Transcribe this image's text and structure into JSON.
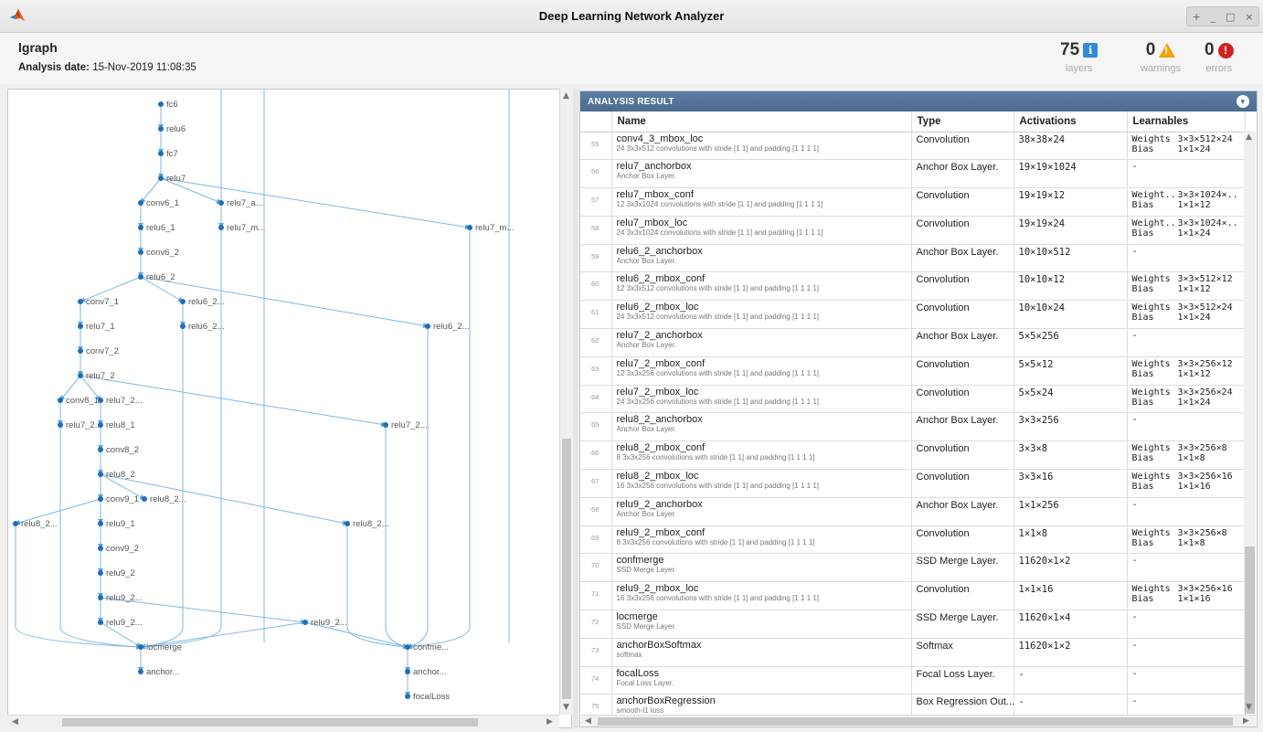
{
  "window": {
    "title": "Deep Learning Network Analyzer",
    "controls": [
      "+",
      "_",
      "□",
      "×"
    ]
  },
  "header": {
    "graph_name": "lgraph",
    "analysis_date_label": "Analysis date:",
    "analysis_date": "15-Nov-2019 11:08:35",
    "layers": {
      "count": "75",
      "label": "layers",
      "icon": "info-icon"
    },
    "warnings": {
      "count": "0",
      "label": "warnings",
      "icon": "warning-icon"
    },
    "errors": {
      "count": "0",
      "label": "errors",
      "icon": "error-icon"
    }
  },
  "graph": {
    "nodes": {
      "fc6": "fc6",
      "relu6": "relu6",
      "fc7": "fc7",
      "relu7": "relu7",
      "conv6_1": "conv6_1",
      "relu7_a": "relu7_a...",
      "relu6_1": "relu6_1",
      "relu7_m1": "relu7_m...",
      "relu7_m2": "relu7_m...",
      "conv6_2": "conv6_2",
      "relu6_2": "relu6_2",
      "conv7_1": "conv7_1",
      "relu6_2a": "relu6_2...",
      "relu7_1": "relu7_1",
      "relu6_2b": "relu6_2...",
      "relu6_2c": "relu6_2...",
      "conv7_2": "conv7_2",
      "relu7_2": "relu7_2",
      "conv8_1": "conv8_1",
      "relu7_2a": "relu7_2...",
      "relu7_2b": "relu7_2...",
      "relu8_1": "relu8_1",
      "relu7_2c": "relu7_2...",
      "conv8_2": "conv8_2",
      "relu8_2": "relu8_2",
      "conv9_1": "conv9_1",
      "relu8_2a": "relu8_2...",
      "relu8_2b": "relu8_2...",
      "relu9_1": "relu9_1",
      "relu8_2c": "relu8_2...",
      "conv9_2": "conv9_2",
      "relu9_2": "relu9_2",
      "relu9_2a": "relu9_2...",
      "relu9_2b": "relu9_2...",
      "relu9_2c": "relu9_2...",
      "locmerge": "locmerge",
      "confme": "confme...",
      "anchor": "anchor...",
      "anchor2": "anchor...",
      "focalLoss": "focalLoss"
    }
  },
  "result": {
    "title": "ANALYSIS RESULT",
    "columns": [
      "",
      "Name",
      "Type",
      "Activations",
      "Learnables"
    ],
    "rows": [
      {
        "idx": "55",
        "name": "conv4_3_mbox_loc",
        "desc": "24 3x3x512 convolutions with stride [1 1] and padding [1 1 1 1]",
        "type": "Convolution",
        "act": "38×38×24",
        "l1k": "Weights",
        "l1v": "3×3×512×24",
        "l2k": "Bias",
        "l2v": "1×1×24"
      },
      {
        "idx": "56",
        "name": "relu7_anchorbox",
        "desc": "Anchor Box Layer.",
        "type": "Anchor Box Layer.",
        "act": "19×19×1024",
        "l1k": "-",
        "l1v": "",
        "l2k": "",
        "l2v": ""
      },
      {
        "idx": "57",
        "name": "relu7_mbox_conf",
        "desc": "12 3x3x1024 convolutions with stride [1 1] and padding [1 1 1 1]",
        "type": "Convolution",
        "act": "19×19×12",
        "l1k": "Weight..",
        "l1v": "3×3×1024×..",
        "l2k": "Bias",
        "l2v": "1×1×12"
      },
      {
        "idx": "58",
        "name": "relu7_mbox_loc",
        "desc": "24 3x3x1024 convolutions with stride [1 1] and padding [1 1 1 1]",
        "type": "Convolution",
        "act": "19×19×24",
        "l1k": "Weight..",
        "l1v": "3×3×1024×..",
        "l2k": "Bias",
        "l2v": "1×1×24"
      },
      {
        "idx": "59",
        "name": "relu6_2_anchorbox",
        "desc": "Anchor Box Layer.",
        "type": "Anchor Box Layer.",
        "act": "10×10×512",
        "l1k": "-",
        "l1v": "",
        "l2k": "",
        "l2v": ""
      },
      {
        "idx": "60",
        "name": "relu6_2_mbox_conf",
        "desc": "12 3x3x512 convolutions with stride [1 1] and padding [1 1 1 1]",
        "type": "Convolution",
        "act": "10×10×12",
        "l1k": "Weights",
        "l1v": "3×3×512×12",
        "l2k": "Bias",
        "l2v": "1×1×12"
      },
      {
        "idx": "61",
        "name": "relu6_2_mbox_loc",
        "desc": "24 3x3x512 convolutions with stride [1 1] and padding [1 1 1 1]",
        "type": "Convolution",
        "act": "10×10×24",
        "l1k": "Weights",
        "l1v": "3×3×512×24",
        "l2k": "Bias",
        "l2v": "1×1×24"
      },
      {
        "idx": "62",
        "name": "relu7_2_anchorbox",
        "desc": "Anchor Box Layer.",
        "type": "Anchor Box Layer.",
        "act": "5×5×256",
        "l1k": "-",
        "l1v": "",
        "l2k": "",
        "l2v": ""
      },
      {
        "idx": "63",
        "name": "relu7_2_mbox_conf",
        "desc": "12 3x3x256 convolutions with stride [1 1] and padding [1 1 1 1]",
        "type": "Convolution",
        "act": "5×5×12",
        "l1k": "Weights",
        "l1v": "3×3×256×12",
        "l2k": "Bias",
        "l2v": "1×1×12"
      },
      {
        "idx": "64",
        "name": "relu7_2_mbox_loc",
        "desc": "24 3x3x256 convolutions with stride [1 1] and padding [1 1 1 1]",
        "type": "Convolution",
        "act": "5×5×24",
        "l1k": "Weights",
        "l1v": "3×3×256×24",
        "l2k": "Bias",
        "l2v": "1×1×24"
      },
      {
        "idx": "65",
        "name": "relu8_2_anchorbox",
        "desc": "Anchor Box Layer.",
        "type": "Anchor Box Layer.",
        "act": "3×3×256",
        "l1k": "-",
        "l1v": "",
        "l2k": "",
        "l2v": ""
      },
      {
        "idx": "66",
        "name": "relu8_2_mbox_conf",
        "desc": "8 3x3x256 convolutions with stride [1 1] and padding [1 1 1 1]",
        "type": "Convolution",
        "act": "3×3×8",
        "l1k": "Weights",
        "l1v": "3×3×256×8",
        "l2k": "Bias",
        "l2v": "1×1×8"
      },
      {
        "idx": "67",
        "name": "relu8_2_mbox_loc",
        "desc": "16 3x3x256 convolutions with stride [1 1] and padding [1 1 1 1]",
        "type": "Convolution",
        "act": "3×3×16",
        "l1k": "Weights",
        "l1v": "3×3×256×16",
        "l2k": "Bias",
        "l2v": "1×1×16"
      },
      {
        "idx": "68",
        "name": "relu9_2_anchorbox",
        "desc": "Anchor Box Layer.",
        "type": "Anchor Box Layer.",
        "act": "1×1×256",
        "l1k": "-",
        "l1v": "",
        "l2k": "",
        "l2v": ""
      },
      {
        "idx": "69",
        "name": "relu9_2_mbox_conf",
        "desc": "8 3x3x256 convolutions with stride [1 1] and padding [1 1 1 1]",
        "type": "Convolution",
        "act": "1×1×8",
        "l1k": "Weights",
        "l1v": "3×3×256×8",
        "l2k": "Bias",
        "l2v": "1×1×8"
      },
      {
        "idx": "70",
        "name": "confmerge",
        "desc": "SSD Merge Layer.",
        "type": "SSD Merge Layer.",
        "act": "11620×1×2",
        "l1k": "-",
        "l1v": "",
        "l2k": "",
        "l2v": ""
      },
      {
        "idx": "71",
        "name": "relu9_2_mbox_loc",
        "desc": "16 3x3x256 convolutions with stride [1 1] and padding [1 1 1 1]",
        "type": "Convolution",
        "act": "1×1×16",
        "l1k": "Weights",
        "l1v": "3×3×256×16",
        "l2k": "Bias",
        "l2v": "1×1×16"
      },
      {
        "idx": "72",
        "name": "locmerge",
        "desc": "SSD Merge Layer.",
        "type": "SSD Merge Layer.",
        "act": "11620×1×4",
        "l1k": "-",
        "l1v": "",
        "l2k": "",
        "l2v": ""
      },
      {
        "idx": "73",
        "name": "anchorBoxSoftmax",
        "desc": "softmax",
        "type": "Softmax",
        "act": "11620×1×2",
        "l1k": "-",
        "l1v": "",
        "l2k": "",
        "l2v": ""
      },
      {
        "idx": "74",
        "name": "focalLoss",
        "desc": "Focal Loss Layer.",
        "type": "Focal Loss Layer.",
        "act": "-",
        "l1k": "-",
        "l1v": "",
        "l2k": "",
        "l2v": ""
      },
      {
        "idx": "75",
        "name": "anchorBoxRegression",
        "desc": "smooth-l1 loss",
        "type": "Box Regression Out...",
        "act": "-",
        "l1k": "-",
        "l1v": "",
        "l2k": "",
        "l2v": ""
      }
    ]
  }
}
